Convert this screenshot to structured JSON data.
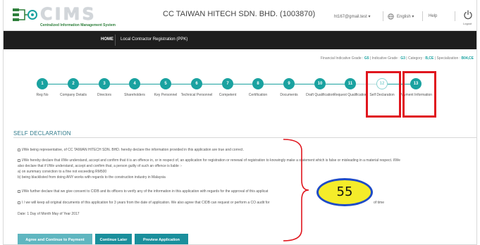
{
  "header": {
    "logo_text": "CIMS",
    "logo_subtitle": "Centralized Information Management System",
    "company": "CC TAIWAN HITECH SDN. BHD. (1003870)",
    "user": "ht167@gmail.test ▾",
    "language": "English ▾",
    "help": "Help",
    "logout": "Logout"
  },
  "nav": {
    "home": "HOME",
    "current": "Local Contractor Registration (PPK)"
  },
  "grades": {
    "financial_label": "Financial Indicative Grade :",
    "financial_value": "G5",
    "indicative_label": "Indicative Grade :",
    "indicative_value": "G3",
    "category_label": "Category :",
    "category_value": "B,CE",
    "specialization_label": "Specialization :",
    "specialization_value": "B04,CE"
  },
  "steps": [
    {
      "num": "1",
      "label": "Reg No"
    },
    {
      "num": "2",
      "label": "Company Details"
    },
    {
      "num": "3",
      "label": "Directors"
    },
    {
      "num": "4",
      "label": "Shareholders"
    },
    {
      "num": "5",
      "label": "Key Personnel"
    },
    {
      "num": "6",
      "label": "Technical Personnel"
    },
    {
      "num": "7",
      "label": "Competent"
    },
    {
      "num": "8",
      "label": "Certification"
    },
    {
      "num": "9",
      "label": "Documents"
    },
    {
      "num": "10",
      "label": "Draft Qualification"
    },
    {
      "num": "11",
      "label": "Request Qualification"
    },
    {
      "num": "12",
      "label": "Self Declaration"
    },
    {
      "num": "13",
      "label": "Payment Information"
    }
  ],
  "section": {
    "title": "SELF DECLARATION",
    "declarations": [
      "I/We being representative, of CC TAIWAN HITECH SDN. BHD. hereby declare the information provided in this application are true and correct.",
      "I/We hereby declare that I/We understand, accept and confirm that it is an offence in, or in respect of, an application for registration or renewal of registration to knowingly make a statement which is false or misleading in a material respect. I/We",
      "also declare that if I/We understand, accept and confirm that, a person guilty of such an offence is liable :-",
      "a)  on summary conviction to a fine not exceeding RM500",
      "b)  being blacklisted from doing ANY works with regards to the construction industry in Malaysia",
      "I/We further declare that we give consent to CIDB and its officers to verify any of the information in this application with regards for the approval of this applicat",
      "I / we will keep all original documents of this application for 3 years from the date of application. We also agree that CIDB can request or perform a CO audit for",
      "of time"
    ],
    "date": "Date: 1 Day of Month May of Year 2017"
  },
  "badge": "55",
  "buttons": {
    "agree": "Agree and Continue to Payment",
    "later": "Continue Later",
    "preview": "Preview Application"
  },
  "colors": {
    "accent": "#1aa2a0",
    "highlight": "#e0161e",
    "badge_fill": "#f5ec2a",
    "badge_border": "#1e4bc7"
  }
}
